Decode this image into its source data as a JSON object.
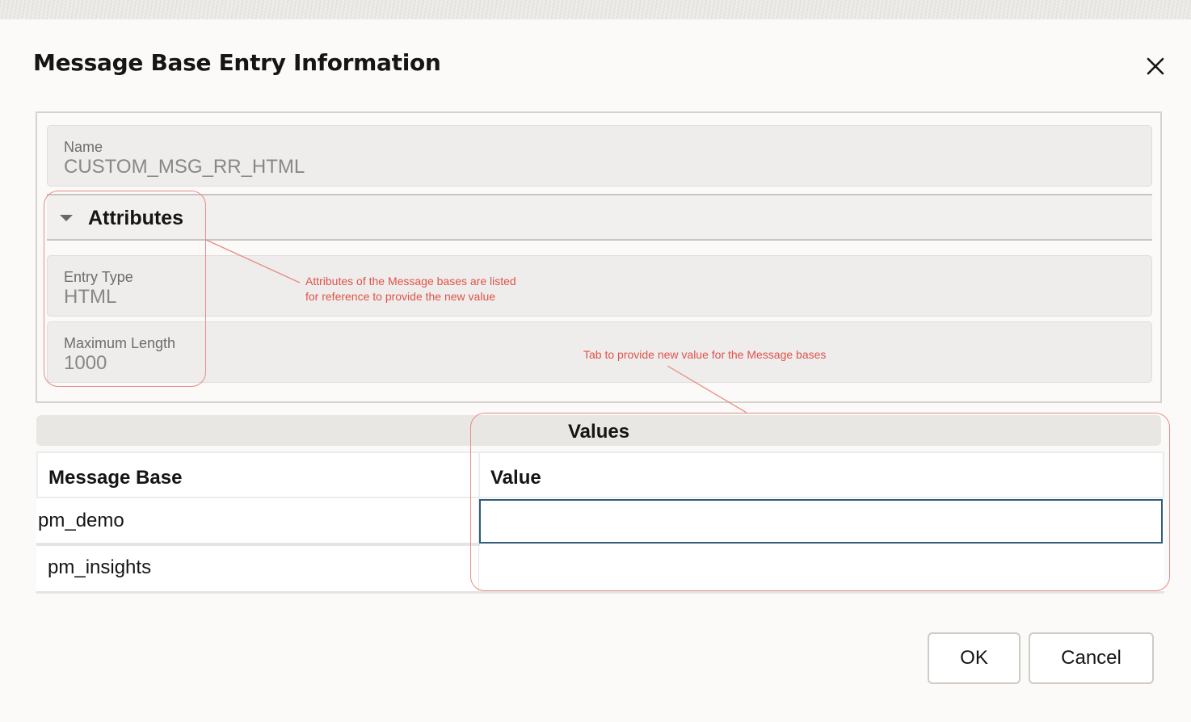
{
  "dialog": {
    "title": "Message Base Entry Information",
    "close_icon": "close-icon"
  },
  "name_field": {
    "label": "Name",
    "value": "CUSTOM_MSG_RR_HTML"
  },
  "attributes": {
    "header": "Attributes",
    "expanded": true,
    "entry_type": {
      "label": "Entry Type",
      "value": "HTML"
    },
    "max_length": {
      "label": "Maximum Length",
      "value": "1000"
    }
  },
  "values_table": {
    "group_title": "Values",
    "columns": [
      "Message Base",
      "Value"
    ],
    "rows": [
      {
        "message_base": "pm_demo",
        "value": ""
      },
      {
        "message_base": "pm_insights",
        "value": ""
      }
    ]
  },
  "annotations": {
    "attributes_note": [
      "Attributes of the Message bases are listed",
      "for reference to provide the new value"
    ],
    "values_note": "Tab to provide new value for the Message bases",
    "color": "#e0524a"
  },
  "buttons": {
    "ok": "OK",
    "cancel": "Cancel"
  }
}
